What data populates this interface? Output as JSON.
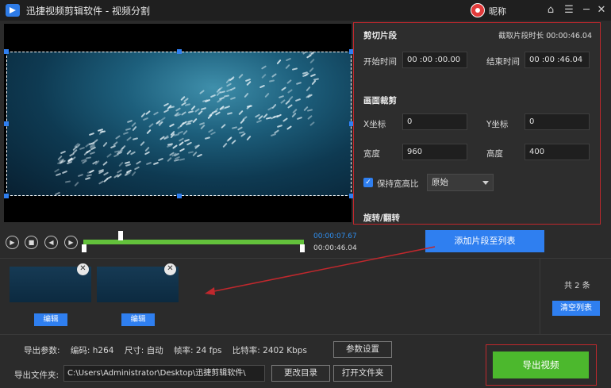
{
  "window": {
    "title": "迅捷视频剪辑软件 - 视频分割",
    "user_name": "昵称",
    "home_icon": "⌂",
    "settings_icon": "☰",
    "minimize_icon": "─",
    "close_icon": "✕"
  },
  "player": {
    "current_time": "00:00:07.67",
    "total_time": "00:00:46.04",
    "playhead_fraction": 0.17,
    "play_icon": "▶",
    "stop_icon": "■",
    "prev_icon": "◀",
    "next_icon": "▶"
  },
  "cut": {
    "section_title": "剪切片段",
    "duration_label": "截取片段时长",
    "duration_value": "00:00:46.04",
    "start_label": "开始时间",
    "start_value": "00 :00 :00.00",
    "end_label": "结束时间",
    "end_value": "00 :00 :46.04"
  },
  "crop": {
    "section_title": "画面裁剪",
    "x_label": "X坐标",
    "x_value": "0",
    "y_label": "Y坐标",
    "y_value": "0",
    "width_label": "宽度",
    "width_value": "960",
    "height_label": "高度",
    "height_value": "400",
    "keep_ratio_label": "保持宽高比",
    "keep_ratio_checked": "✓",
    "ratio_option": "原始"
  },
  "rotate": {
    "section_title": "旋转/翻转"
  },
  "actions": {
    "add_clip_label": "添加片段至列表",
    "clear_list_label": "清空列表",
    "count_text": "共 2 条"
  },
  "clips": [
    {
      "edit_label": "编辑",
      "close_icon": "✕"
    },
    {
      "edit_label": "编辑",
      "close_icon": "✕"
    }
  ],
  "export": {
    "params_label": "导出参数:",
    "codec": "编码: h264",
    "size": "尺寸: 自动",
    "fps": "帧率: 24 fps",
    "bitrate": "比特率: 2402 Kbps",
    "param_settings_label": "参数设置",
    "folder_label": "导出文件夹:",
    "folder_path": "C:\\Users\\Administrator\\Desktop\\迅捷剪辑软件\\",
    "change_dir_label": "更改目录",
    "open_folder_label": "打开文件夹",
    "export_label": "导出视频"
  },
  "colors": {
    "accent_blue": "#2f7ff0",
    "export_green": "#4cb82d",
    "highlight_red": "#c0282d",
    "timeline_green": "#63c13b"
  }
}
